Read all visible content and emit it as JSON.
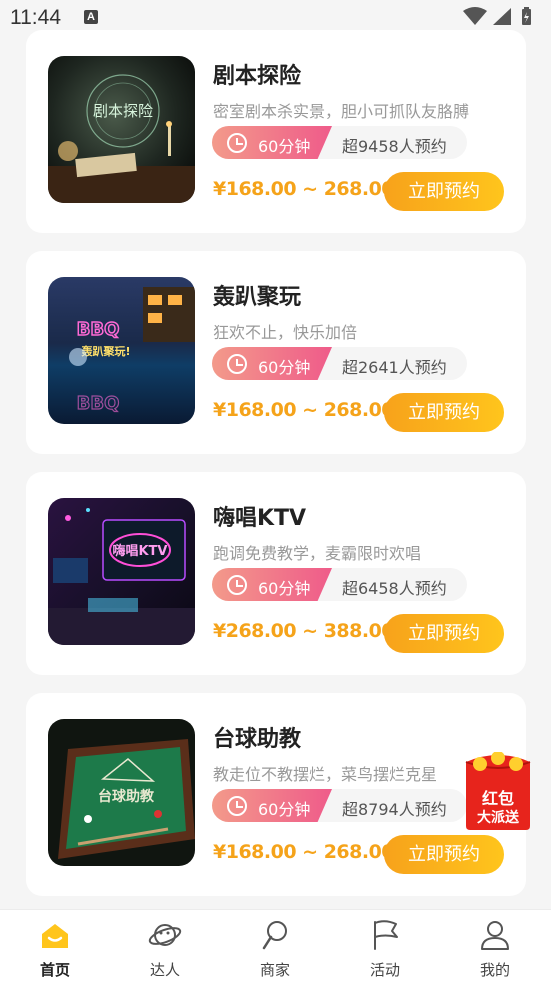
{
  "status_bar": {
    "time": "11:44",
    "notification_letter": "A"
  },
  "currency": "¥",
  "items": [
    {
      "title": "剧本探险",
      "description": "密室剧本杀实景，胆小可抓队友胳膊",
      "duration": "60分钟",
      "booked": "超9458人预约",
      "price": "¥168.00 ~ 268.00",
      "button": "立即预约",
      "thumb_text": "剧本探险"
    },
    {
      "title": "轰趴聚玩",
      "description": "狂欢不止，快乐加倍",
      "duration": "60分钟",
      "booked": "超2641人预约",
      "price": "¥168.00 ~ 268.00",
      "button": "立即预约",
      "thumb_text": "轰趴聚玩!"
    },
    {
      "title": "嗨唱KTV",
      "description": "跑调免费教学，麦霸限时欢唱",
      "duration": "60分钟",
      "booked": "超6458人预约",
      "price": "¥268.00 ~ 388.00",
      "button": "立即预约",
      "thumb_text": "嗨唱KTV"
    },
    {
      "title": "台球助教",
      "description": "教走位不教摆烂，菜鸟摆烂克星",
      "duration": "60分钟",
      "booked": "超8794人预约",
      "price": "¥168.00 ~ 268.00",
      "button": "立即预约",
      "thumb_text": "台球助教"
    }
  ],
  "red_packet": {
    "line1": "红包",
    "line2": "大派送"
  },
  "tabs": [
    {
      "label": "首页",
      "icon": "home-icon",
      "active": true
    },
    {
      "label": "达人",
      "icon": "planet-icon",
      "active": false
    },
    {
      "label": "商家",
      "icon": "shop-icon",
      "active": false
    },
    {
      "label": "活动",
      "icon": "flag-icon",
      "active": false
    },
    {
      "label": "我的",
      "icon": "user-icon",
      "active": false
    }
  ],
  "colors": {
    "price": "#f5a31a",
    "button_gradient": [
      "#f7a21b",
      "#ffc51c"
    ],
    "duration_gradient": [
      "#f39a8a",
      "#ef5b8a"
    ],
    "active_tab": "#ffc51c"
  }
}
